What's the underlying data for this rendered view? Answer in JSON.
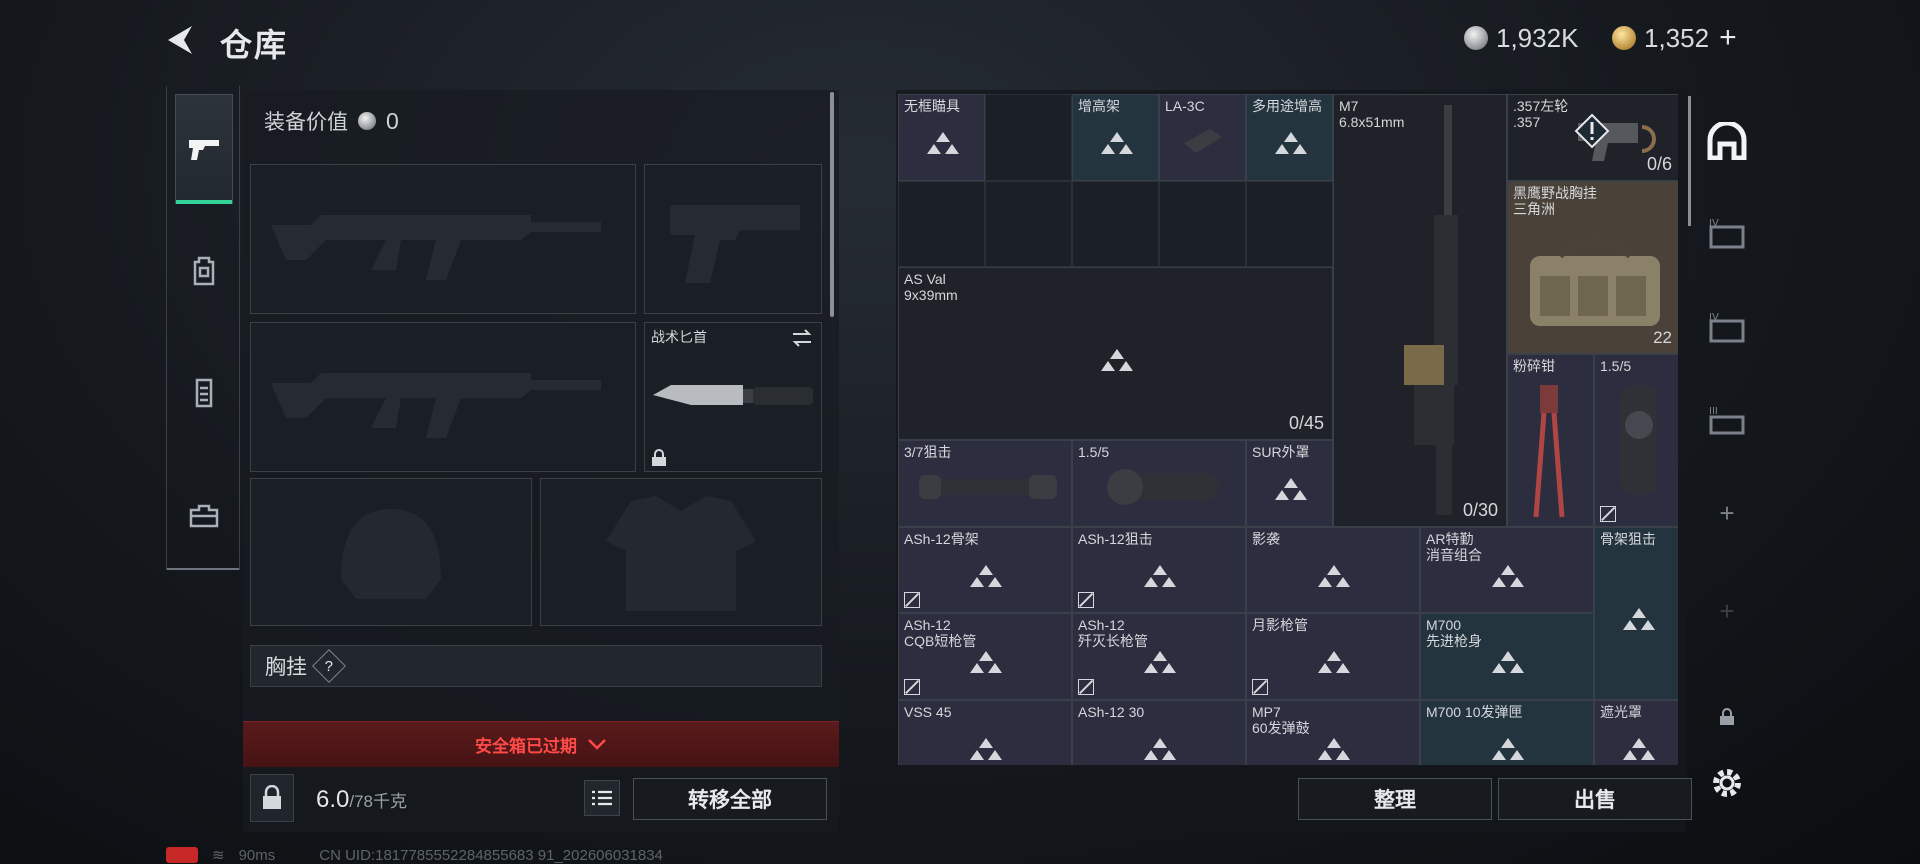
{
  "header": {
    "title": "仓库",
    "currency_silver": "1,932K",
    "currency_gold": "1,352",
    "plus_label": "+"
  },
  "left_tabs": [
    {
      "icon": "pistol-icon"
    },
    {
      "icon": "backpack-icon"
    },
    {
      "icon": "vest-icon"
    },
    {
      "icon": "toolbox-icon"
    }
  ],
  "equipment": {
    "value_label": "装备价值",
    "value": "0",
    "melee_slot_label": "战术匕首",
    "vest_label": "胸挂",
    "help_label": "?"
  },
  "safe_box": {
    "expired_label": "安全箱已过期"
  },
  "footer_left": {
    "weight_value": "6.0",
    "weight_capacity": "/78千克",
    "transfer_all_label": "转移全部"
  },
  "status": {
    "ping": "90ms",
    "uid": "CN UID:1817785552284855683 91_202606031834"
  },
  "stash": {
    "cells": [
      {
        "label": "无框瞄具",
        "count": ""
      },
      {
        "label": "增高架",
        "count": ""
      },
      {
        "label": "LA-3C",
        "count": ""
      },
      {
        "label": "多用途增高",
        "count": ""
      },
      {
        "label": "M7\n6.8x51mm",
        "count": "0/30"
      },
      {
        "label": ".357左轮\n.357",
        "count": "0/6"
      },
      {
        "label": "黑鹰野战胸挂\n三角洲",
        "count": "22"
      },
      {
        "label": "AS Val\n9x39mm",
        "count": "0/45"
      },
      {
        "label": "粉碎钳",
        "count": ""
      },
      {
        "label": "1.5/5",
        "count": ""
      },
      {
        "label": "3/7狙击",
        "count": ""
      },
      {
        "label": "1.5/5",
        "count": ""
      },
      {
        "label": "SUR外罩",
        "count": ""
      },
      {
        "label": "ASh-12骨架",
        "count": ""
      },
      {
        "label": "ASh-12狙击",
        "count": ""
      },
      {
        "label": "影袭",
        "count": ""
      },
      {
        "label": "AR特勤\n消音组合",
        "count": ""
      },
      {
        "label": "骨架狙击",
        "count": ""
      },
      {
        "label": "ASh-12\nCQB短枪管",
        "count": ""
      },
      {
        "label": "ASh-12\n歼灭长枪管",
        "count": ""
      },
      {
        "label": "月影枪管",
        "count": ""
      },
      {
        "label": "M700\n先进枪身",
        "count": ""
      },
      {
        "label": "VSS 45",
        "count": ""
      },
      {
        "label": "ASh-12 30",
        "count": ""
      },
      {
        "label": "MP7\n60发弹鼓",
        "count": ""
      },
      {
        "label": "M700 10发弹匣",
        "count": ""
      },
      {
        "label": "遮光罩",
        "count": ""
      }
    ]
  },
  "actions": {
    "organize_label": "整理",
    "sell_label": "出售"
  },
  "colors": {
    "accent_green": "#34d39a",
    "warning_red": "#ff4a48",
    "item_purple": "#2c2d3e",
    "item_teal": "#24343f"
  }
}
